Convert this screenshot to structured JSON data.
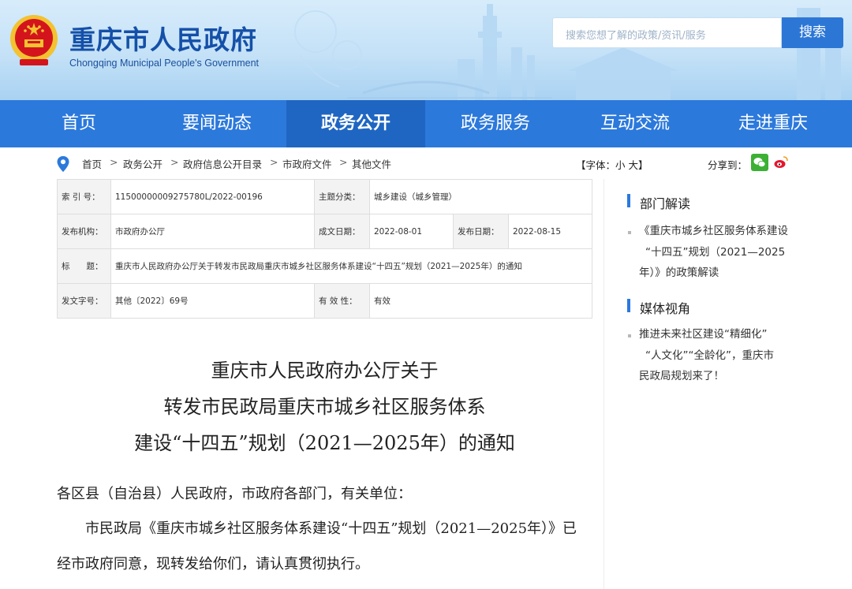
{
  "header": {
    "title": "重庆市人民政府",
    "subtitle": "Chongqing Municipal People's Government",
    "search_placeholder": "搜索您想了解的政策/资讯/服务",
    "search_button": "搜索"
  },
  "nav": [
    "首页",
    "要闻动态",
    "政务公开",
    "政务服务",
    "互动交流",
    "走进重庆"
  ],
  "nav_active": "政务公开",
  "breadcrumb": [
    "首页",
    ">",
    "政务公开",
    ">",
    "政府信息公开目录",
    ">",
    "市政府文件",
    ">",
    "其他文件"
  ],
  "font_control": "【字体：小 大】",
  "share_label": "分享到：",
  "info": {
    "index_label": "索 引 号：",
    "index_value": "11500000009275780L/2022-00196",
    "topic_label": "主题分类：",
    "topic_value": "城乡建设（城乡管理）",
    "issuer_label": "发布机构：",
    "issuer_value": "市政府办公厅",
    "written_label": "成文日期：",
    "written_value": "2022-08-01",
    "published_label": "发布日期：",
    "published_value": "2022-08-15",
    "title_label": "标　　题：",
    "title_value": "重庆市人民政府办公厅关于转发市民政局重庆市城乡社区服务体系建设“十四五”规划（2021—2025年）的通知",
    "docno_label": "发文字号：",
    "docno_value": "其他〔2022〕69号",
    "valid_label": "有 效 性：",
    "valid_value": "有效"
  },
  "article": {
    "title_lines": [
      "重庆市人民政府办公厅关于",
      "转发市民政局重庆市城乡社区服务体系",
      "建设“十四五”规划（2021—2025年）的通知"
    ],
    "salutation": "各区县（自治县）人民政府，市政府各部门，有关单位：",
    "para1_line1": "市民政局《重庆市城乡社区服务体系建设“十四五”规划（2021—2025年）》已",
    "para1_line2": "经市政府同意，现转发给你们，请认真贯彻执行。"
  },
  "sidebar": {
    "section1": "部门解读",
    "section1_items": [
      [
        "《重庆市城乡社区服务体系建设",
        "“十四五”规划（2021—2025",
        "年）》的政策解读"
      ]
    ],
    "section2": "媒体视角",
    "section2_items": [
      [
        "推进未来社区建设“精细化”",
        "“人文化”“全龄化”，重庆市",
        "民政局规划来了！"
      ]
    ]
  },
  "colors": {
    "nav_blue": "#2c79dc",
    "nav_active": "#1f66c2",
    "title_blue": "#1550a8",
    "emblem_red": "#d4141c",
    "emblem_gold": "#f2c230"
  }
}
